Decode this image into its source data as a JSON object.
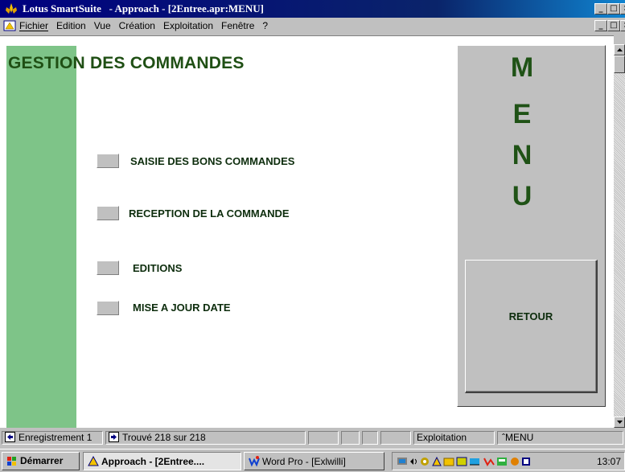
{
  "window": {
    "title": "Lotus SmartSuite   - Approach - [2Entree.apr:MENU]"
  },
  "menubar": {
    "items": [
      "Fichier",
      "Edition",
      "Vue",
      "Création",
      "Exploitation",
      "Fenêtre",
      "?"
    ]
  },
  "form": {
    "title": "GESTION DES COMMANDES",
    "buttons": [
      {
        "label": "SAISIE DES BONS COMMANDES"
      },
      {
        "label": "RECEPTION DE LA COMMANDE"
      },
      {
        "label": "EDITIONS"
      },
      {
        "label": "MISE A JOUR DATE"
      }
    ],
    "menu_letters": [
      "M",
      "E",
      "N",
      "U"
    ],
    "retour_label": "RETOUR"
  },
  "statusbar": {
    "record": "Enregistrement 1",
    "found": "Trouvé 218 sur 218",
    "mode": "Exploitation",
    "view": "MENU"
  },
  "taskbar": {
    "start_label": "Démarrer",
    "tasks": [
      {
        "label": "Approach - [2Entree...."
      },
      {
        "label": "Word Pro - [Exlwilli]"
      }
    ],
    "clock": "13:07"
  },
  "colors": {
    "title_bar": "#000080",
    "green_band": "#7ec488",
    "form_text": "#1f4f14",
    "menu_letters": "#1f5216",
    "chrome": "#c0c0c0"
  }
}
